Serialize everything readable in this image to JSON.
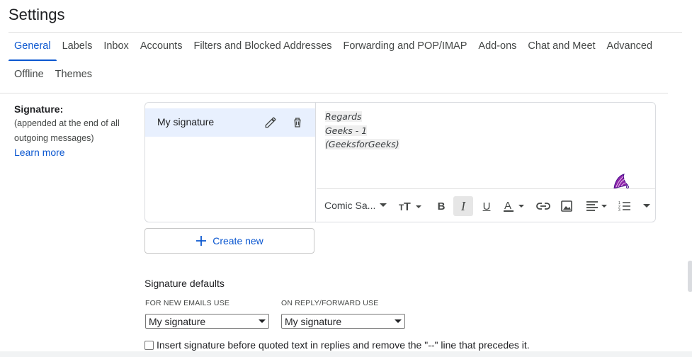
{
  "page": {
    "title": "Settings"
  },
  "tabs": {
    "row1": [
      "General",
      "Labels",
      "Inbox",
      "Accounts",
      "Filters and Blocked Addresses",
      "Forwarding and POP/IMAP",
      "Add-ons",
      "Chat and Meet",
      "Advanced"
    ],
    "row2": [
      "Offline",
      "Themes"
    ],
    "active": "General"
  },
  "signature": {
    "title": "Signature:",
    "desc_line1": "(appended at the end of all",
    "desc_line2": "outgoing messages)",
    "learn_more": "Learn more",
    "items": [
      {
        "name": "My signature"
      }
    ],
    "body_lines": [
      "Regards",
      "Geeks - 1",
      "(GeeksforGeeks)"
    ],
    "toolbar": {
      "font": "Comic Sa...",
      "active_format": "italic"
    },
    "create_new": "Create new"
  },
  "defaults": {
    "title": "Signature defaults",
    "new_emails_label": "FOR NEW EMAILS USE",
    "new_emails_value": "My signature",
    "reply_label": "ON REPLY/FORWARD USE",
    "reply_value": "My signature",
    "insert_before_quoted": "Insert signature before quoted text in replies and remove the \"--\" line that precedes it.",
    "insert_checked": false
  },
  "colors": {
    "accent": "#0b57d0",
    "selected_bg": "#e8f0fe",
    "cursor_purple": "#8e24aa"
  }
}
